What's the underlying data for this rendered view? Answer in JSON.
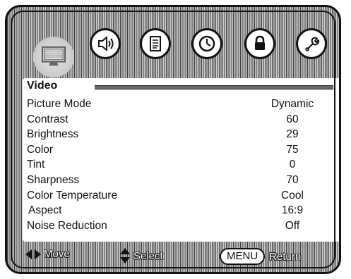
{
  "tabs": [
    {
      "icon": "picture-icon",
      "active": true
    },
    {
      "icon": "speaker-icon",
      "active": false
    },
    {
      "icon": "document-icon",
      "active": false
    },
    {
      "icon": "clock-icon",
      "active": false
    },
    {
      "icon": "lock-icon",
      "active": false
    },
    {
      "icon": "wrench-icon",
      "active": false
    }
  ],
  "panel": {
    "title": "Video",
    "rows": [
      {
        "label": "Picture Mode",
        "value": "Dynamic"
      },
      {
        "label": "Contrast",
        "value": "60"
      },
      {
        "label": "Brightness",
        "value": "29"
      },
      {
        "label": "Color",
        "value": "75"
      },
      {
        "label": "Tint",
        "value": "0"
      },
      {
        "label": "Sharpness",
        "value": "70"
      },
      {
        "label": "Color Temperature",
        "value": "Cool"
      },
      {
        "label": "Aspect",
        "value": "16:9"
      },
      {
        "label": "Noise Reduction",
        "value": "Off"
      }
    ]
  },
  "footer": {
    "move_label": "Move",
    "select_label": "Select",
    "menu_key": "MENU",
    "return_label": "Return"
  }
}
